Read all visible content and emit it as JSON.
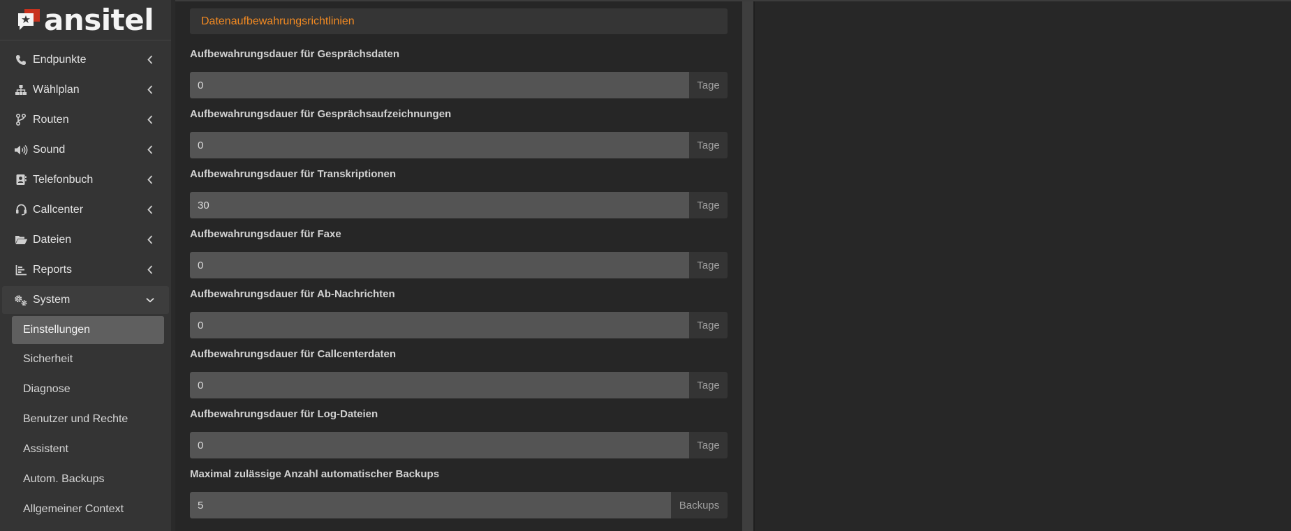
{
  "brand": {
    "name": "ansitel"
  },
  "sidebar": {
    "items": [
      {
        "label": "Endpunkte",
        "icon": "phone-icon"
      },
      {
        "label": "Wählplan",
        "icon": "sitemap-icon"
      },
      {
        "label": "Routen",
        "icon": "code-branch-icon"
      },
      {
        "label": "Sound",
        "icon": "volume-icon"
      },
      {
        "label": "Telefonbuch",
        "icon": "address-book-icon"
      },
      {
        "label": "Callcenter",
        "icon": "headset-icon"
      },
      {
        "label": "Dateien",
        "icon": "folder-open-icon"
      },
      {
        "label": "Reports",
        "icon": "chart-bar-icon"
      },
      {
        "label": "System",
        "icon": "gears-icon",
        "expanded": true
      }
    ],
    "subitems": [
      {
        "label": "Einstellungen",
        "active": true
      },
      {
        "label": "Sicherheit"
      },
      {
        "label": "Diagnose"
      },
      {
        "label": "Benutzer und Rechte"
      },
      {
        "label": "Assistent"
      },
      {
        "label": "Autom. Backups"
      },
      {
        "label": "Allgemeiner Context"
      }
    ]
  },
  "panel": {
    "title": "Datenaufbewahrungsrichtlinien",
    "fields": [
      {
        "label": "Aufbewahrungsdauer für Gesprächsdaten",
        "value": "0",
        "unit": "Tage"
      },
      {
        "label": "Aufbewahrungsdauer für Gesprächsaufzeichnungen",
        "value": "0",
        "unit": "Tage"
      },
      {
        "label": "Aufbewahrungsdauer für Transkriptionen",
        "value": "30",
        "unit": "Tage"
      },
      {
        "label": "Aufbewahrungsdauer für Faxe",
        "value": "0",
        "unit": "Tage"
      },
      {
        "label": "Aufbewahrungsdauer für Ab-Nachrichten",
        "value": "0",
        "unit": "Tage"
      },
      {
        "label": "Aufbewahrungsdauer für Callcenterdaten",
        "value": "0",
        "unit": "Tage"
      },
      {
        "label": "Aufbewahrungsdauer für Log-Dateien",
        "value": "0",
        "unit": "Tage"
      },
      {
        "label": "Maximal zulässige Anzahl automatischer Backups",
        "value": "5",
        "unit": "Backups"
      }
    ]
  },
  "colors": {
    "accent": "#f28a22",
    "logo_red": "#c8321e",
    "sidebar_bg": "#343434",
    "page_bg": "#262626"
  }
}
